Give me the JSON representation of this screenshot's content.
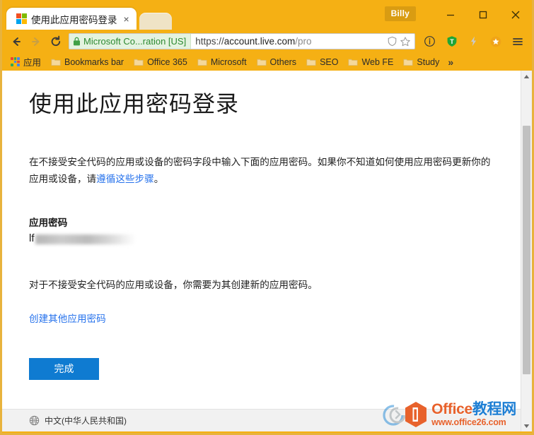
{
  "window": {
    "profile_name": "Billy",
    "minimize_label": "Minimize",
    "maximize_label": "Maximize",
    "close_label": "Close"
  },
  "tabs": [
    {
      "title": "使用此应用密码登录",
      "favicon": "microsoft-logo-icon",
      "close": "×"
    }
  ],
  "toolbar": {
    "back_icon": "back-arrow-icon",
    "forward_icon": "forward-arrow-icon",
    "reload_icon": "reload-icon",
    "ev_badge_text": "Microsoft Co...ration [US]",
    "lock_icon": "lock-icon",
    "url_scheme": "https://",
    "url_host": "account.live.com",
    "url_path": "/pro",
    "omni_icons": [
      "shield-icon",
      "star-icon"
    ],
    "extensions": [
      "info-circle-icon",
      "shield-t-icon",
      "lightning-icon",
      "orange-star-icon",
      "menu-icon"
    ]
  },
  "bookmarks": {
    "apps_label": "应用",
    "items": [
      {
        "label": "Bookmarks bar",
        "icon": "folder-icon"
      },
      {
        "label": "Office 365",
        "icon": "folder-icon"
      },
      {
        "label": "Microsoft",
        "icon": "folder-icon"
      },
      {
        "label": "Others",
        "icon": "folder-icon"
      },
      {
        "label": "SEO",
        "icon": "folder-icon"
      },
      {
        "label": "Web FE",
        "icon": "folder-icon"
      },
      {
        "label": "Study",
        "icon": "folder-icon"
      }
    ],
    "overflow": "»"
  },
  "page": {
    "title": "使用此应用密码登录",
    "paragraph1_before_link": "在不接受安全代码的应用或设备的密码字段中输入下面的应用密码。如果你不知道如何使用应用密码更新你的应用或设备，请",
    "paragraph1_link": "遵循这些步骤",
    "paragraph1_after_link": "。",
    "password_label": "应用密码",
    "password_visible_prefix": "lf",
    "password_redacted": true,
    "paragraph2": "对于不接受安全代码的应用或设备，你需要为其创建新的应用密码。",
    "create_another_link": "创建其他应用密码",
    "done_button": "完成"
  },
  "footer": {
    "globe_icon": "globe-icon",
    "language": "中文(中华人民共和国)"
  },
  "scrollbar": {
    "up_arrow": "▲",
    "down_arrow": "▼"
  },
  "watermark": {
    "title_orange": "Office",
    "title_blue": "教程网",
    "url": "www.office26.com"
  },
  "colors": {
    "frame": "#f5b014",
    "accent_button": "#0f7bd1",
    "link": "#2672ec",
    "ev_green": "#2c8a31",
    "watermark_orange": "#e8622c",
    "watermark_blue": "#1e7fd4"
  }
}
